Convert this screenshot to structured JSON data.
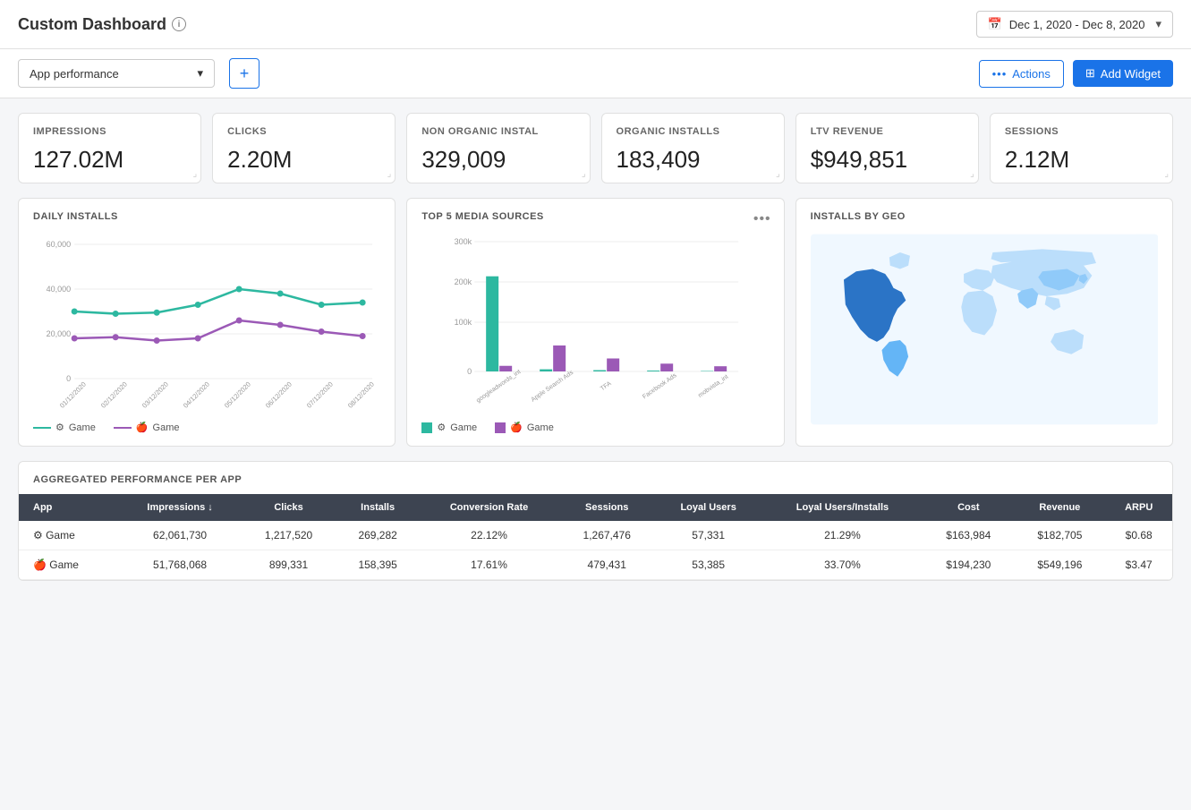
{
  "header": {
    "title": "Custom Dashboard",
    "info_label": "i",
    "date_range": "Dec 1, 2020 - Dec 8, 2020"
  },
  "subheader": {
    "dropdown_value": "App performance",
    "plus_label": "+",
    "actions_label": "Actions",
    "add_widget_label": "Add Widget"
  },
  "kpi_cards": [
    {
      "label": "IMPRESSIONS",
      "value": "127.02M"
    },
    {
      "label": "CLICKS",
      "value": "2.20M"
    },
    {
      "label": "NON ORGANIC INSTAL",
      "value": "329,009"
    },
    {
      "label": "ORGANIC INSTALLS",
      "value": "183,409"
    },
    {
      "label": "LTV REVENUE",
      "value": "$949,851"
    },
    {
      "label": "SESSIONS",
      "value": "2.12M"
    }
  ],
  "daily_installs": {
    "title": "DAILY INSTALLS",
    "legend": [
      {
        "label": "Game",
        "color": "#2db8a0",
        "icon": "android"
      },
      {
        "label": "Game",
        "color": "#9b59b6",
        "icon": "apple"
      }
    ],
    "x_labels": [
      "01/12/2020",
      "02/12/2020",
      "03/12/2020",
      "04/12/2020",
      "05/12/2020",
      "06/12/2020",
      "07/12/2020",
      "08/12/2020"
    ],
    "y_labels": [
      "60,000",
      "40,000",
      "20,000",
      "0"
    ],
    "series1": [
      30000,
      29000,
      29500,
      33000,
      40000,
      38000,
      33000,
      34000
    ],
    "series2": [
      18000,
      18500,
      17000,
      18000,
      26000,
      24000,
      21000,
      19000
    ]
  },
  "top5_media": {
    "title": "TOP 5 MEDIA SOURCES",
    "legend": [
      {
        "label": "Game",
        "color": "#2db8a0",
        "icon": "android"
      },
      {
        "label": "Game",
        "color": "#9b59b6",
        "icon": "apple"
      }
    ],
    "x_labels": [
      "googleadwords_int",
      "Apple Search Ads",
      "TFA",
      "Facebook Ads",
      "mobvista_int"
    ],
    "y_labels": [
      "300k",
      "200k",
      "100k",
      "0"
    ],
    "bars": [
      {
        "android": 220000,
        "apple": 15000
      },
      {
        "android": 5000,
        "apple": 60000
      },
      {
        "android": 3000,
        "apple": 30000
      },
      {
        "android": 2000,
        "apple": 18000
      },
      {
        "android": 1000,
        "apple": 12000
      }
    ]
  },
  "installs_by_geo": {
    "title": "INSTALLS BY GEO"
  },
  "table": {
    "title": "AGGREGATED PERFORMANCE PER APP",
    "columns": [
      "App",
      "Impressions ↓",
      "Clicks",
      "Installs",
      "Conversion Rate",
      "Sessions",
      "Loyal Users",
      "Loyal Users/Installs",
      "Cost",
      "Revenue",
      "ARPU"
    ],
    "rows": [
      {
        "app": "Game",
        "icon": "android",
        "impressions": "62,061,730",
        "clicks": "1,217,520",
        "installs": "269,282",
        "conv_rate": "22.12%",
        "sessions": "1,267,476",
        "loyal_users": "57,331",
        "loyal_installs": "21.29%",
        "cost": "$163,984",
        "revenue": "$182,705",
        "arpu": "$0.68"
      },
      {
        "app": "Game",
        "icon": "apple",
        "impressions": "51,768,068",
        "clicks": "899,331",
        "installs": "158,395",
        "conv_rate": "17.61%",
        "sessions": "479,431",
        "loyal_users": "53,385",
        "loyal_installs": "33.70%",
        "cost": "$194,230",
        "revenue": "$549,196",
        "arpu": "$3.47"
      }
    ]
  },
  "colors": {
    "teal": "#2db8a0",
    "purple": "#9b59b6",
    "blue": "#1a73e8",
    "header_bg": "#3d4451",
    "map_highlight": "#1565c0",
    "map_medium": "#64b5f6",
    "map_light": "#bbdefb"
  }
}
